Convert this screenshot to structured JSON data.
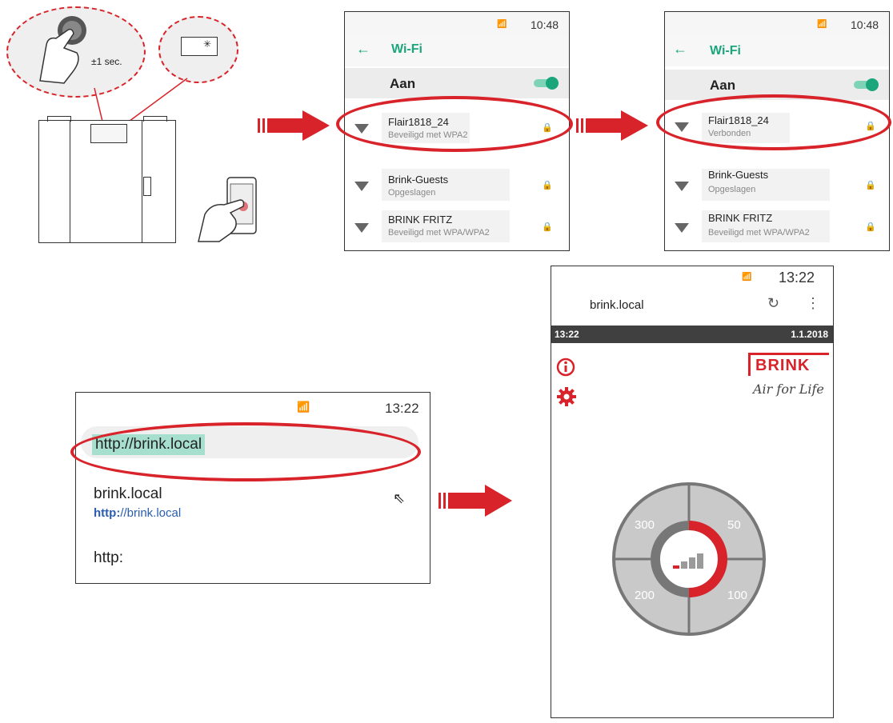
{
  "step1": {
    "press_label": "±1 sec."
  },
  "phone_wifi_1": {
    "time": "10:48",
    "title": "Wi-Fi",
    "toggle_label": "Aan",
    "networks": [
      {
        "name": "Flair1818_24",
        "status": "Beveiligd met WPA2"
      },
      {
        "name": "Brink-Guests",
        "status": "Opgeslagen"
      },
      {
        "name": "BRINK FRITZ",
        "status": "Beveiligd met WPA/WPA2"
      }
    ]
  },
  "phone_wifi_2": {
    "time": "10:48",
    "title": "Wi-Fi",
    "toggle_label": "Aan",
    "networks": [
      {
        "name": "Flair1818_24",
        "status": "Verbonden"
      },
      {
        "name": "Brink-Guests",
        "status": "Opgeslagen"
      },
      {
        "name": "BRINK FRITZ",
        "status": "Beveiligd met WPA/WPA2"
      }
    ]
  },
  "browser": {
    "time": "13:22",
    "url_input": "http://brink.local",
    "suggestion_title": "brink.local",
    "suggestion_url_scheme": "http:",
    "suggestion_url_rest": "//brink.local",
    "typed_fragment": "http:"
  },
  "brink_app": {
    "time": "13:22",
    "url": "brink.local",
    "bar_time": "13:22",
    "bar_date": "1.1.2018",
    "logo": "BRINK",
    "tagline": "Air for Life",
    "dial": {
      "labels": [
        "300",
        "50",
        "200",
        "100"
      ],
      "level": 1,
      "levels_total": 4
    }
  },
  "colors": {
    "accent_red": "#d8232a",
    "wifi_green": "#1aa67a",
    "link_blue": "#2a5db0"
  }
}
